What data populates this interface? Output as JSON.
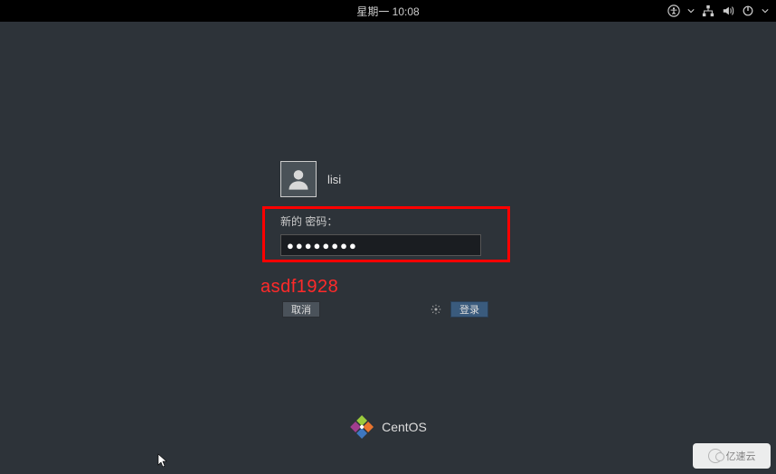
{
  "topbar": {
    "clock": "星期一 10:08"
  },
  "login": {
    "username": "lisi",
    "password_label": "新的 密码：",
    "password_masked": "●●●●●●●●",
    "cancel_label": "取消",
    "login_label": "登录"
  },
  "annotation": "asdf1928",
  "branding": {
    "name": "CentOS"
  },
  "watermark": {
    "text": "亿速云"
  }
}
